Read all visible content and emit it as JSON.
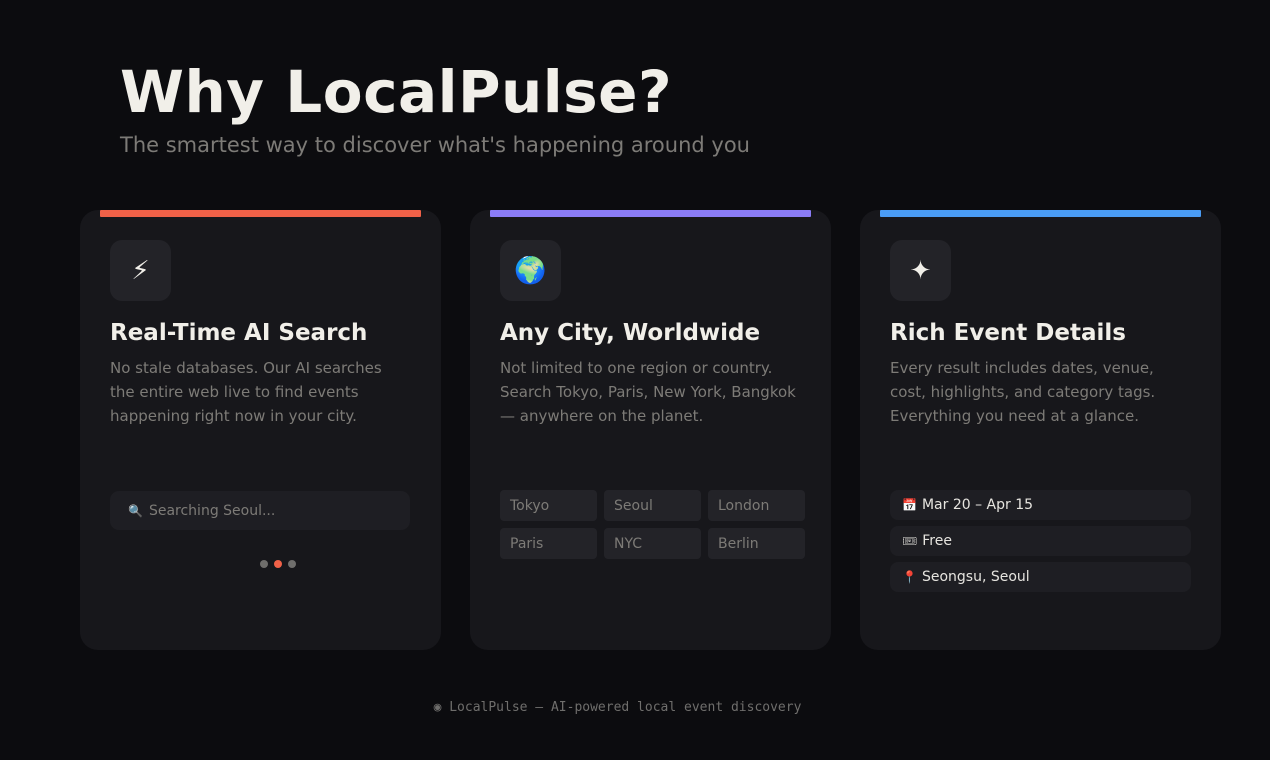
{
  "hero": {
    "title": "Why LocalPulse?",
    "subtitle": "The smartest way to discover what's happening around you"
  },
  "colors": {
    "card1_accent": "#f06148",
    "card2_accent": "#8b7cf6",
    "card3_accent": "#4a9cf5"
  },
  "cards": [
    {
      "icon": "lightning-icon",
      "icon_glyph": "⚡",
      "title": "Real-Time AI Search",
      "description": "No stale databases. Our AI searches the entire web live to find events happening right now in your city.",
      "search_icon": "search-icon",
      "search_glyph": "🔍",
      "search_text": "Searching Seoul..."
    },
    {
      "icon": "globe-icon",
      "icon_glyph": "🌍",
      "title": "Any City, Worldwide",
      "description": "Not limited to one region or country. Search Tokyo, Paris, New York, Bangkok — anywhere on the planet.",
      "cities": [
        "Tokyo",
        "Seoul",
        "London",
        "Paris",
        "NYC",
        "Berlin"
      ]
    },
    {
      "icon": "sparkle-icon",
      "icon_glyph": "✦",
      "title": "Rich Event Details",
      "description": "Every result includes dates, venue, cost, highlights, and category tags. Everything you need at a glance.",
      "details": [
        {
          "icon": "calendar-icon",
          "glyph": "📅",
          "text": "Mar 20 – Apr 15"
        },
        {
          "icon": "ticket-icon",
          "glyph": "🎟",
          "text": "Free"
        },
        {
          "icon": "pin-icon",
          "glyph": "📍",
          "text": "Seongsu, Seoul"
        }
      ]
    }
  ],
  "footer": {
    "text": "◉ LocalPulse — AI-powered local event discovery"
  }
}
